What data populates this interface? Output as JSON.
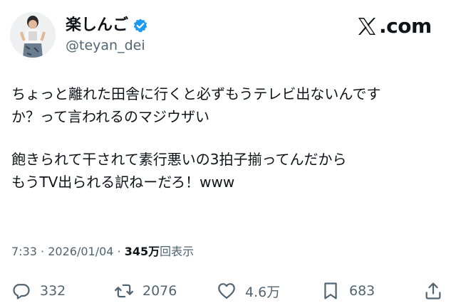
{
  "author": {
    "display_name": "楽しんご",
    "handle": "@teyan_dei",
    "verified": true,
    "avatar_icon": "avatar-photo"
  },
  "brand": {
    "text": ".com",
    "icon": "x-logo-icon"
  },
  "post": {
    "lines": [
      "ちょっと離れた田舎に行くと必ずもうテレビ出ないんです",
      "か？って言われるのマジウザい",
      "",
      "飽きられて干されて素行悪いの3拍子揃ってんだから",
      "もうTV出られる訳ねーだろ！www"
    ]
  },
  "meta": {
    "time": "7:33",
    "separator": "·",
    "date": "2026/01/04",
    "views": "345万",
    "views_label": "回表示"
  },
  "actions": {
    "replies": "332",
    "reposts": "2076",
    "likes": "4.6万",
    "bookmarks": "683"
  },
  "colors": {
    "text": "#0f1419",
    "secondary": "#536471",
    "verified": "#1d9bf0"
  }
}
